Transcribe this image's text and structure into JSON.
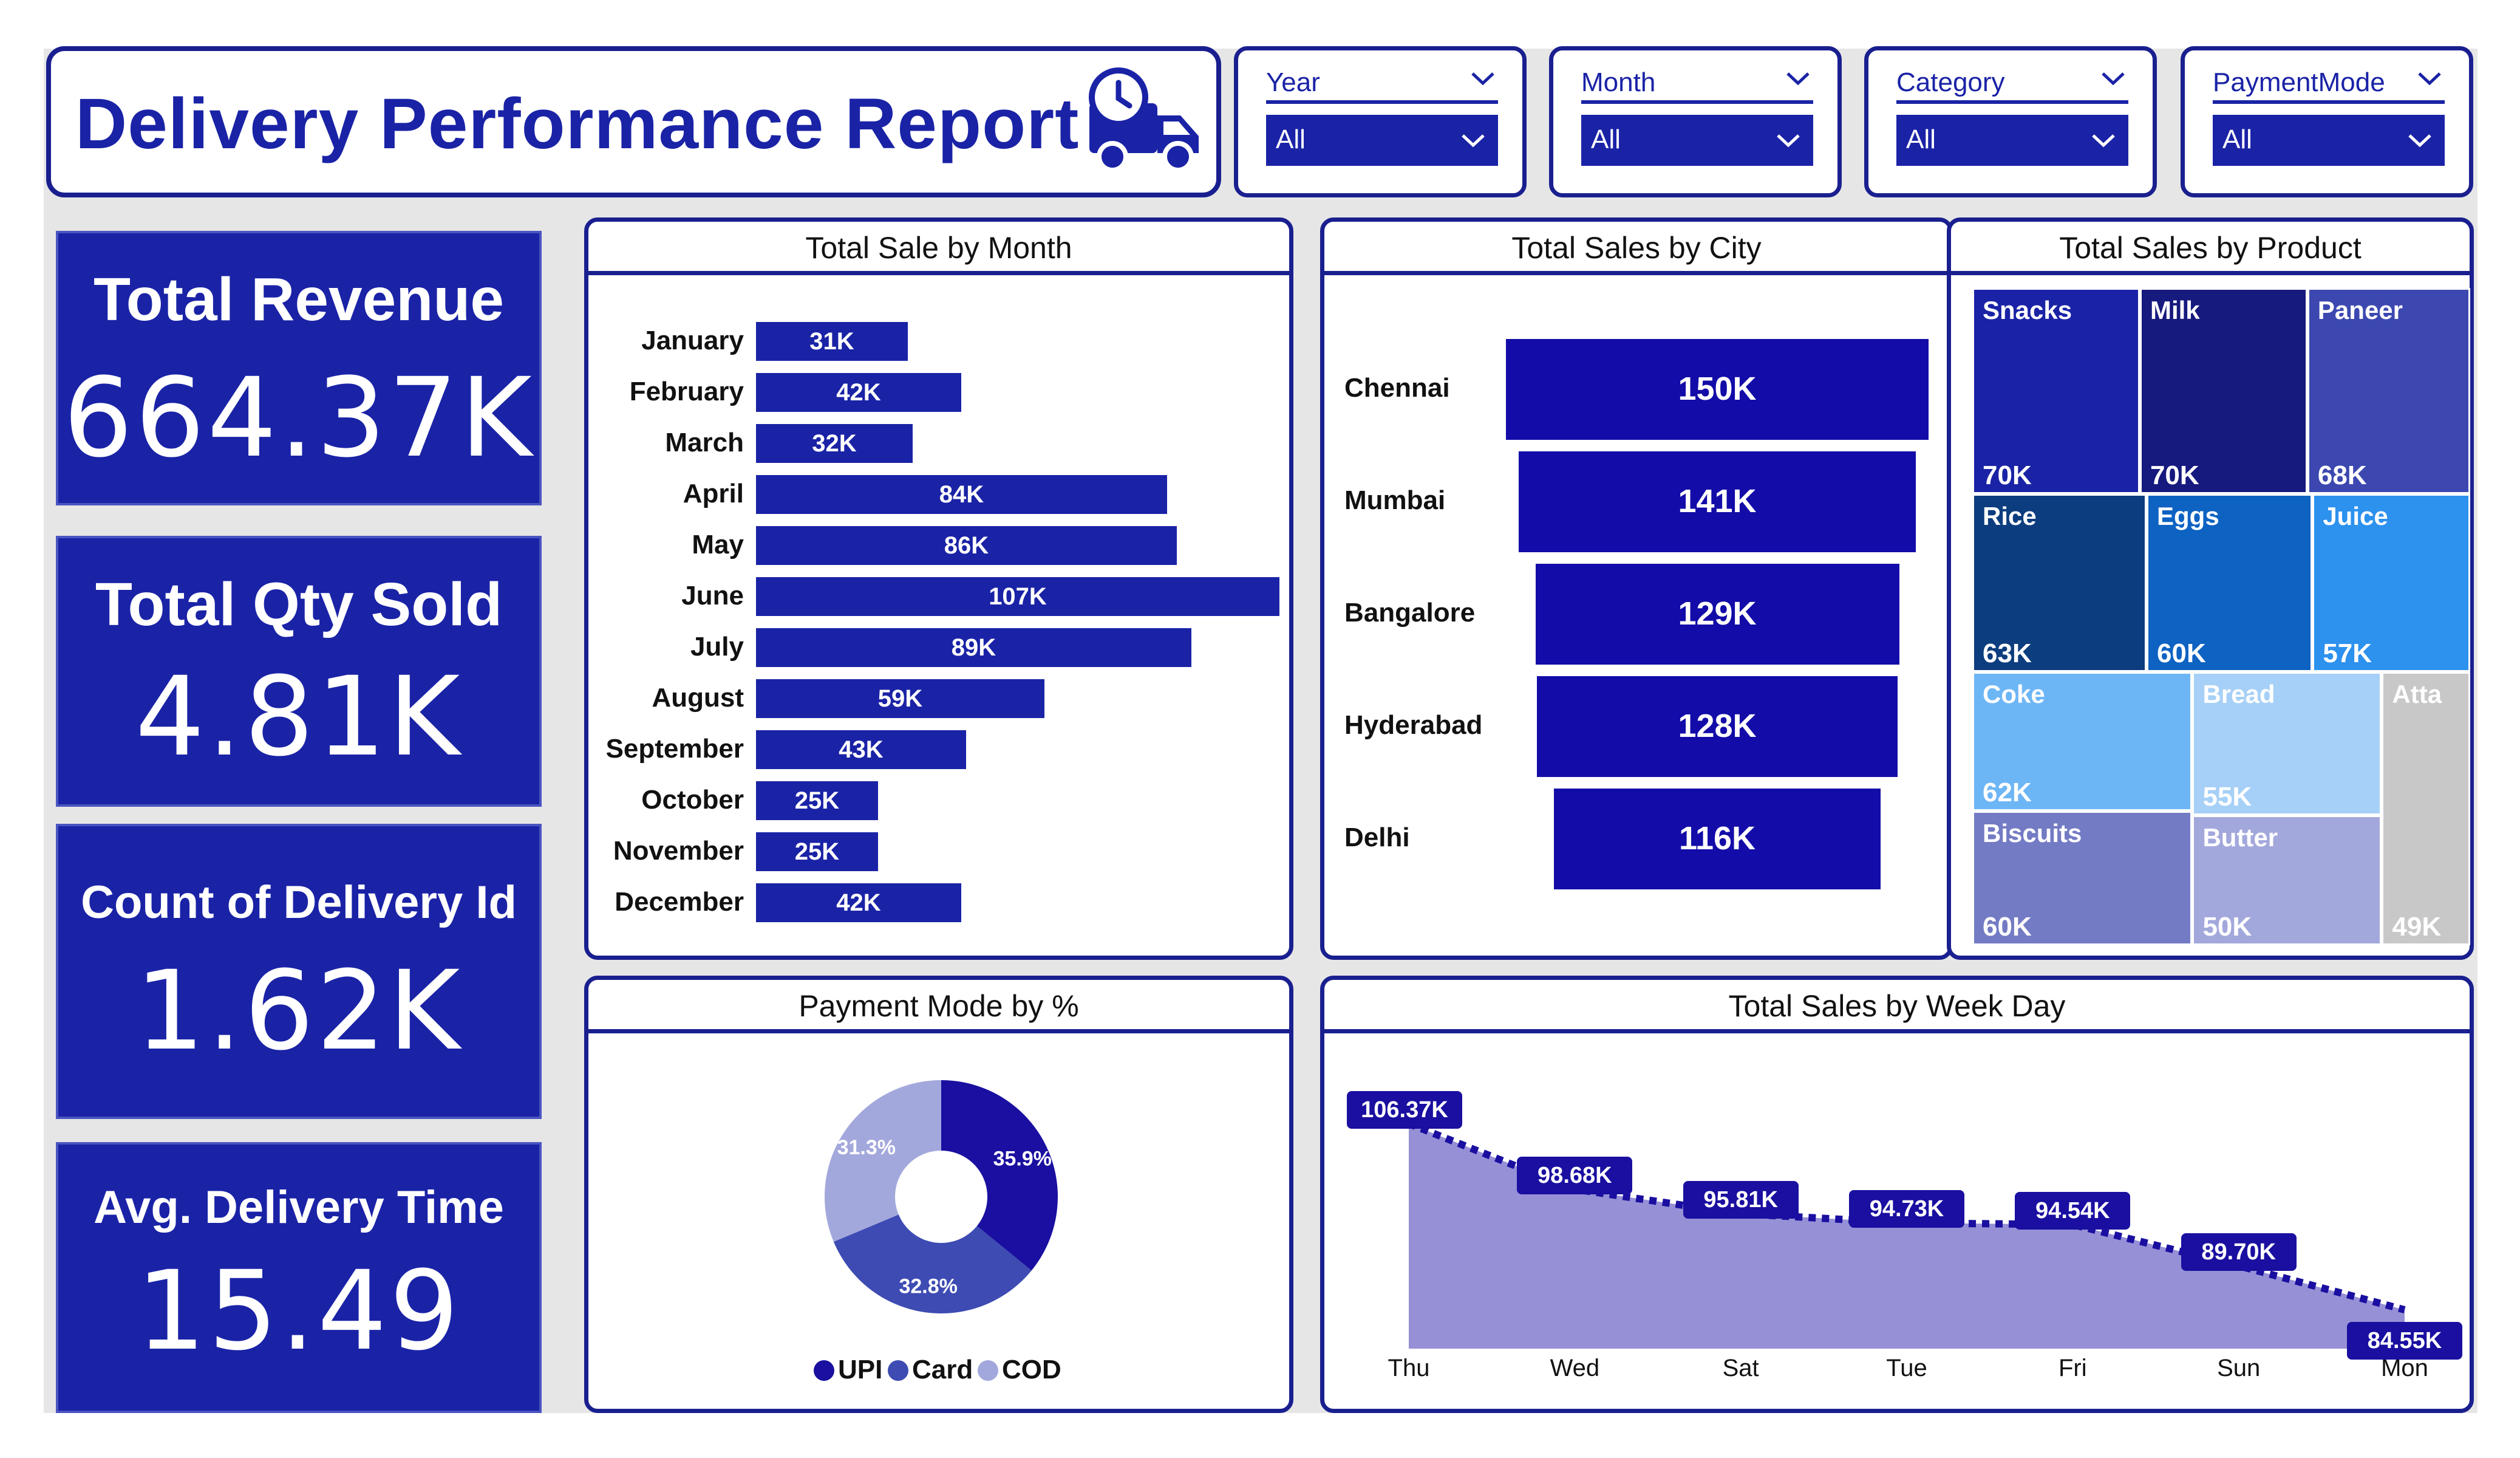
{
  "header": {
    "title": "Delivery Performance Report",
    "icon": "delivery-truck-clock-icon"
  },
  "filters": [
    {
      "label": "Year",
      "value": "All"
    },
    {
      "label": "Month",
      "value": "All"
    },
    {
      "label": "Category",
      "value": "All"
    },
    {
      "label": "PaymentMode",
      "value": "All"
    }
  ],
  "kpis": [
    {
      "label": "Total Revenue",
      "value": "664.37K"
    },
    {
      "label": "Total Qty Sold",
      "value": "4.81K"
    },
    {
      "label": "Count of Delivery Id",
      "value": "1.62K"
    },
    {
      "label": "Avg. Delivery Time",
      "value": "15.49"
    }
  ],
  "colors": {
    "primary": "#1a23a6",
    "border": "#1a1f8f",
    "funnel": "#130ca8",
    "upi": "#1a0fa0",
    "card": "#3d4bb3",
    "cod": "#a3a8dc",
    "area_fill": "#9690d6"
  },
  "chart_data": [
    {
      "type": "bar",
      "title": "Total Sale by Month",
      "orientation": "horizontal",
      "categories": [
        "January",
        "February",
        "March",
        "April",
        "May",
        "June",
        "July",
        "August",
        "September",
        "October",
        "November",
        "December"
      ],
      "values": [
        31,
        42,
        32,
        84,
        86,
        107,
        89,
        59,
        43,
        25,
        25,
        42
      ],
      "labels": [
        "31K",
        "42K",
        "32K",
        "84K",
        "86K",
        "107K",
        "89K",
        "59K",
        "43K",
        "25K",
        "25K",
        "42K"
      ],
      "unit": "K"
    },
    {
      "type": "bar",
      "title": "Total Sales by City",
      "orientation": "funnel",
      "categories": [
        "Chennai",
        "Mumbai",
        "Bangalore",
        "Hyderabad",
        "Delhi"
      ],
      "values": [
        150,
        141,
        129,
        128,
        116
      ],
      "labels": [
        "150K",
        "141K",
        "129K",
        "128K",
        "116K"
      ],
      "unit": "K"
    },
    {
      "type": "heatmap",
      "title": "Total Sales by Product",
      "categories": [
        "Snacks",
        "Milk",
        "Paneer",
        "Rice",
        "Eggs",
        "Juice",
        "Coke",
        "Bread",
        "Atta",
        "Biscuits",
        "Butter"
      ],
      "values": [
        70,
        70,
        68,
        63,
        60,
        57,
        62,
        55,
        49,
        60,
        50
      ],
      "labels": [
        "70K",
        "70K",
        "68K",
        "63K",
        "60K",
        "57K",
        "62K",
        "55K",
        "49K",
        "60K",
        "50K"
      ],
      "colors": [
        "#1a23a6",
        "#161a7e",
        "#3c48b0",
        "#0c3d7e",
        "#0d62c2",
        "#2d91ee",
        "#6db6f6",
        "#a6d0f7",
        "#c8c8c8",
        "#737bc4",
        "#a3a8dc"
      ]
    },
    {
      "type": "pie",
      "title": "Payment Mode by %",
      "categories": [
        "UPI",
        "Card",
        "COD"
      ],
      "values": [
        35.9,
        32.8,
        31.3
      ],
      "labels": [
        "35.9%",
        "32.8%",
        "31.3%"
      ]
    },
    {
      "type": "area",
      "title": "Total Sales by Week Day",
      "categories": [
        "Thu",
        "Wed",
        "Sat",
        "Tue",
        "Fri",
        "Sun",
        "Mon"
      ],
      "values": [
        106.37,
        98.68,
        95.81,
        94.73,
        94.54,
        89.7,
        84.55
      ],
      "labels": [
        "106.37K",
        "98.68K",
        "95.81K",
        "94.73K",
        "94.54K",
        "89.70K",
        "84.55K"
      ],
      "unit": "K"
    }
  ]
}
